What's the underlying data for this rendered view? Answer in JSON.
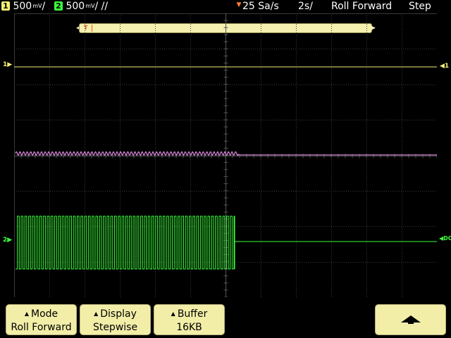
{
  "status_bar": {
    "ch1_number": "1",
    "ch1_scale": "500",
    "ch1_units": "mV",
    "ch2_number": "2",
    "ch2_scale": "500",
    "ch2_units": "mV",
    "sample_rate": "25 Sa/s",
    "time_per_div": "2s/",
    "mode": "Roll Forward",
    "state": "Step"
  },
  "overview": {
    "trigger_label": "T"
  },
  "markers": {
    "ch1_left": "1",
    "ch1_right": "1",
    "ch2_left": "2",
    "ch2_right": "DC"
  },
  "softkeys": [
    {
      "title": "Mode",
      "value": "Roll Forward"
    },
    {
      "title": "Display",
      "value": "Stepwise"
    },
    {
      "title": "Buffer",
      "value": "16KB"
    }
  ],
  "colors": {
    "ch1": "#f5f074",
    "ch2": "#3cff3c",
    "math": "#ff9cff",
    "trigger": "#ff7b3a",
    "softkey_bg": "#f2eea8"
  },
  "icons": {
    "up_softkey": "up-arrow-icon"
  }
}
